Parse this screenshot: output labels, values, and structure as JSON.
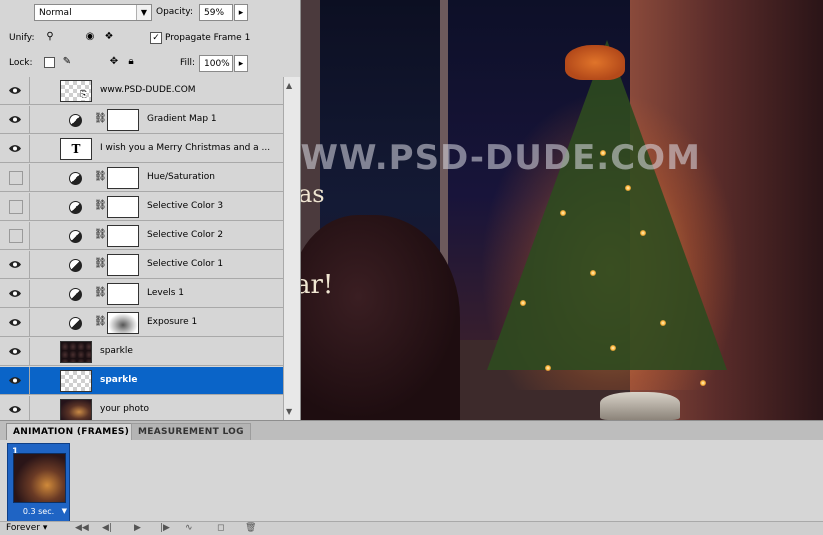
{
  "blend": {
    "mode": "Normal"
  },
  "opacity": {
    "label": "Opacity:",
    "value": "59%"
  },
  "unify": {
    "label": "Unify:",
    "propagate_label": "Propagate Frame 1",
    "propagate_checked": true
  },
  "lock": {
    "label": "Lock:"
  },
  "fill": {
    "label": "Fill:",
    "value": "100%"
  },
  "layers": [
    {
      "name": "www.PSD-DUDE.COM",
      "visible": true,
      "kind": "smart"
    },
    {
      "name": "Gradient Map 1",
      "visible": true,
      "kind": "adjustment"
    },
    {
      "name": "I wish you a Merry Christmas and a ...",
      "visible": true,
      "kind": "text",
      "thumb_glyph": "T"
    },
    {
      "name": "Hue/Saturation",
      "visible": false,
      "kind": "adjustment"
    },
    {
      "name": "Selective Color 3",
      "visible": false,
      "kind": "adjustment"
    },
    {
      "name": "Selective Color 2",
      "visible": false,
      "kind": "adjustment"
    },
    {
      "name": "Selective Color 1",
      "visible": true,
      "kind": "adjustment"
    },
    {
      "name": "Levels 1",
      "visible": true,
      "kind": "adjustment"
    },
    {
      "name": "Exposure 1",
      "visible": true,
      "kind": "adjustment"
    },
    {
      "name": "sparkle",
      "visible": true,
      "kind": "pixel"
    },
    {
      "name": "sparkle",
      "visible": true,
      "kind": "pixel",
      "selected": true
    },
    {
      "name": "your photo",
      "visible": true,
      "kind": "photo"
    }
  ],
  "canvas": {
    "watermark": "WWW.PSD-DUDE.COM",
    "text_fragment_1": "as",
    "text_fragment_2": "ar!"
  },
  "animation": {
    "tabs": [
      "ANIMATION (FRAMES)",
      "MEASUREMENT LOG"
    ],
    "frame": {
      "number": "1",
      "delay": "0.3 sec."
    },
    "loop": "Forever"
  },
  "colors": {
    "selection": "#0a64c8",
    "panel": "#d6d6d6"
  }
}
